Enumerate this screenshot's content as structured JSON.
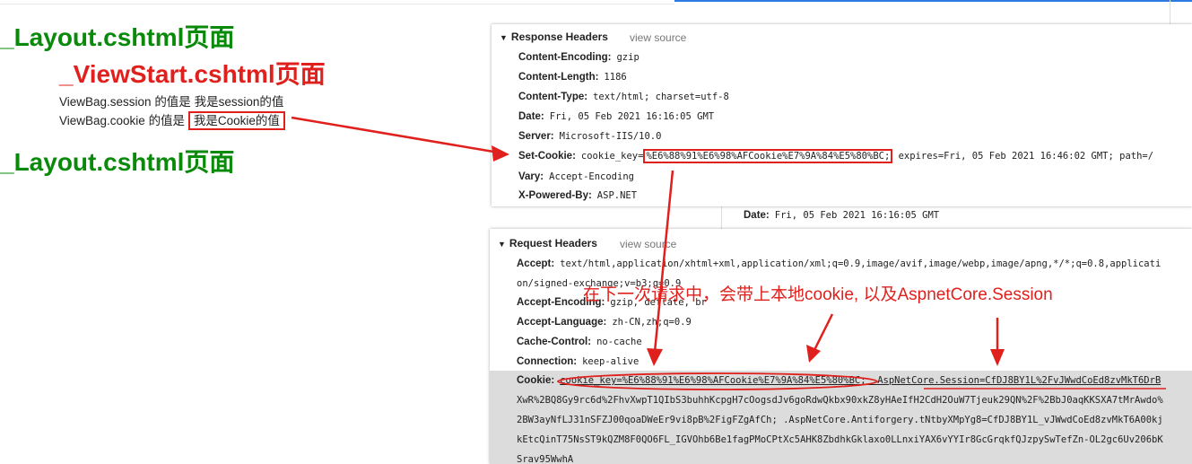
{
  "page": {
    "layout_title_1": "_Layout.cshtml页面",
    "viewstart_title": "_ViewStart.cshtml页面",
    "session_line_prefix": "ViewBag.session 的值是",
    "session_value": "我是session的值",
    "cookie_line_prefix": "ViewBag.cookie 的值是",
    "cookie_value": "我是Cookie的值",
    "layout_title_2": "_Layout.cshtml页面"
  },
  "response_headers": {
    "title": "Response Headers",
    "view_source": "view source",
    "content_encoding": {
      "name": "Content-Encoding:",
      "value": "gzip"
    },
    "content_length": {
      "name": "Content-Length:",
      "value": "1186"
    },
    "content_type": {
      "name": "Content-Type:",
      "value": "text/html; charset=utf-8"
    },
    "date": {
      "name": "Date:",
      "value": "Fri, 05 Feb 2021 16:16:05 GMT"
    },
    "server": {
      "name": "Server:",
      "value": "Microsoft-IIS/10.0"
    },
    "set_cookie": {
      "name": "Set-Cookie:",
      "prefix": "cookie_key=",
      "value": "%E6%88%91%E6%98%AFCookie%E7%9A%84%E5%80%BC;",
      "suffix": " expires=Fri, 05 Feb 2021 16:46:02 GMT; path=/"
    },
    "vary": {
      "name": "Vary:",
      "value": "Accept-Encoding"
    },
    "x_powered_by": {
      "name": "X-Powered-By:",
      "value": "ASP.NET"
    }
  },
  "background_panel": {
    "date": {
      "name": "Date:",
      "value": "Fri, 05 Feb 2021 16:16:05 GMT"
    }
  },
  "request_headers": {
    "title": "Request Headers",
    "view_source": "view source",
    "accept": {
      "name": "Accept:",
      "value": "text/html,application/xhtml+xml,application/xml;q=0.9,image/avif,image/webp,image/apng,*/*;q=0.8,applicati",
      "line2": "on/signed-exchange;v=b3;q=0.9"
    },
    "accept_encoding": {
      "name": "Accept-Encoding:",
      "value": "gzip, deflate, br"
    },
    "accept_language": {
      "name": "Accept-Language:",
      "value": "zh-CN,zh;q=0.9"
    },
    "cache_control": {
      "name": "Cache-Control:",
      "value": "no-cache"
    },
    "connection": {
      "name": "Connection:",
      "value": "keep-alive"
    },
    "cookie": {
      "name": "Cookie:",
      "value1": "cookie_key=%E6%88%91%E6%98%AFCookie%E7%9A%84%E5%80%BC;",
      "value2": " .AspNetCore.Session=CfDJ8BY1L%2FvJWwdCoEd8zvMkT6DrB",
      "line2": "XwR%2BQ8Gy9rc6d%2FhvXwpT1QIbS3buhhKcpgH7cOogsdJv6goRdwQkbx90xkZ8yHAeIfH2CdH2OuW7Tjeuk29QN%2F%2BbJ0aqKKSXA7tMrAwdo%",
      "line3": "2BW3ayNfLJ31nSFZJ00qoaDWeEr9vi8pB%2FigFZgAfCh; .AspNetCore.Antiforgery.tNtbyXMpYg8=CfDJ8BY1L_vJWwdCoEd8zvMkT6A00kj",
      "line4": "kEtcQinT75NsST9kQZM8F0QO6FL_IGVOhb6Be1fagPMoCPtXc5AHK8ZbdhkGklaxo0LLnxiYAX6vYYIr8GcGrqkfQJzpySwTefZn-OL2gc6Uv206bK",
      "line5": "Srav95WwhA"
    }
  },
  "annotation": {
    "text": "在下一次请求中，会带上本地cookie, 以及AspnetCore.Session",
    "color": "#e0201c"
  }
}
